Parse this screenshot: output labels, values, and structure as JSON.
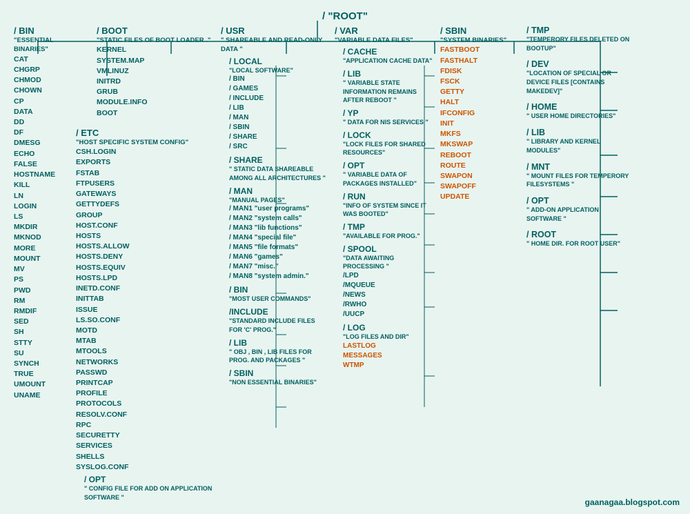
{
  "root": {
    "label": "/   \"ROOT\""
  },
  "bin": {
    "title": "/ BIN",
    "desc": "\"ESSENTIAL BINARIES\"",
    "files": [
      "CAT",
      "CHGRP",
      "CHMOD",
      "CHOWN",
      "CP",
      "DATA",
      "DD",
      "DF",
      "DMESG",
      "ECHO",
      "FALSE",
      "HOSTNAME",
      "KILL",
      "LN",
      "LOGIN",
      "LS",
      "MKDIR",
      "MKNOD",
      "MORE",
      "MOUNT",
      "MV",
      "PS",
      "PWD",
      "RM",
      "RMDIF",
      "SED",
      "SH",
      "STTY",
      "SU",
      "SYNCH",
      "TRUE",
      "UMOUNT",
      "UNAME"
    ]
  },
  "boot": {
    "title": "/ BOOT",
    "desc": "\"STATIC FILES OF BOOT LOADER .\"",
    "files": [
      "KERNEL",
      "SYSTEM.MAP",
      "VMLINUZ",
      "INITRD",
      "GRUB",
      "MODULE.INFO",
      "BOOT"
    ]
  },
  "etc": {
    "title": "/ ETC",
    "desc": "\"HOST SPECIFIC SYSTEM CONFIG\"",
    "files": [
      "CSH.LOGIN",
      "EXPORTS",
      "FSTAB",
      "FTPUSERS",
      "GATEWAYS",
      "GETTYDEFS",
      "GROUP",
      "HOST.CONF",
      "HOSTS",
      "HOSTS.ALLOW",
      "HOSTS.DENY",
      "HOSTS.EQUIV",
      "HOSTS.LPD",
      "INETD.CONF",
      "INITTAB",
      "ISSUE",
      "LS.SO.CONF",
      "MOTD",
      "MTAB",
      "MTOOLS",
      "NETWORKS",
      "PASSWD",
      "PRINTCAP",
      "PROFILE",
      "PROTOCOLS",
      "RESOLV.CONF",
      "RPC",
      "SECURETTY",
      "SERVICES",
      "SHELLS",
      "SYSLOG.CONF"
    ],
    "opt": {
      "title": "/ OPT",
      "desc": "\" CONFIG FILE FOR ADD ON APPLICATION SOFTWARE \""
    }
  },
  "usr": {
    "title": "/ USR",
    "desc": "\" SHAREABLE AND READ-ONLY DATA \"",
    "local": {
      "title": "/ LOCAL",
      "desc": "\"LOCAL SOFTWARE\"",
      "items": [
        "/BIN",
        "/GAMES",
        "/INCLUDE",
        "/LIB",
        "/MAN",
        "/SBIN",
        "/SHARE",
        "/SRC"
      ]
    },
    "share": {
      "title": "/ SHARE",
      "desc": "\" STATIC DATA SHAREABLE AMONG ALL ARCHITECTURES \""
    },
    "man": {
      "title": "/ MAN",
      "desc": "\"MANUAL PAGES\"",
      "items": [
        "/MAN1 \"user programs\"",
        "/MAN2 \"system calls\"",
        "/MAN3 \"lib functions\"",
        "/MAN4 \"special file\"",
        "/MAN5 \"file formats\"",
        "/MAN6 \"games\"",
        "/MAN7 \"misc.\"",
        "/MAN8 \"system admin.\""
      ]
    },
    "bin": {
      "title": "/ BIN",
      "desc": "\"MOST USER COMMANDS\""
    },
    "include": {
      "title": "/INCLUDE",
      "desc": "\"STANDARD INCLUDE FILES FOR 'C' PROG.\""
    },
    "lib": {
      "title": "/ LIB",
      "desc": "\" OBJ , BIN , LIB FILES FOR PROG. AND PACKAGES \""
    },
    "sbin": {
      "title": "/ SBIN",
      "desc": "\"NON ESSENTIAL BINARIES\""
    }
  },
  "var": {
    "title": "/ VAR",
    "desc": "\"VARIABLE DATA FILES\"",
    "cache": {
      "title": "/ CACHE",
      "desc": "\"APPLICATION CACHE DATA\""
    },
    "lib": {
      "title": "/ LIB",
      "desc": "\" VARIABLE STATE INFORMATION REMAINS AFTER REBOOT \""
    },
    "yp": {
      "title": "/ YP",
      "desc": "\" DATA FOR NIS SERVICES \""
    },
    "lock": {
      "title": "/ LOCK",
      "desc": "\"LOCK FILES FOR SHARED RESOURCES\""
    },
    "opt": {
      "title": "/ OPT",
      "desc": "\" VARIABLE DATA OF PACKAGES INSTALLED\""
    },
    "run": {
      "title": "/ RUN",
      "desc": "\"INFO OF SYSTEM SINCE IT WAS BOOTED\""
    },
    "tmp": {
      "title": "/ TMP",
      "desc": "\"AVAILABLE FOR PROG.\""
    },
    "spool": {
      "title": "/ SPOOL",
      "desc": "\"DATA AWAITING PROCESSING \"",
      "items": [
        "/LPD",
        "/MQUEUE",
        "/NEWS",
        "/RWHO",
        "/UUCP"
      ]
    },
    "log": {
      "title": "/ LOG",
      "desc": "\"LOG FILES AND DIR\"",
      "items_orange": [
        "LASTLOG",
        "MESSAGES",
        "WTMP"
      ]
    }
  },
  "sbin": {
    "title": "/ SBIN",
    "desc": "\"SYSTEM BINARIES\"",
    "files_normal": [],
    "files_orange": [
      "FASTBOOT",
      "FASTHALT",
      "FDISK",
      "FSCK",
      "GETTY",
      "HALT",
      "IFCONFIG",
      "INIT",
      "MKFS",
      "MKSWAP",
      "REBOOT",
      "ROUTE",
      "SWAPON",
      "SWAPOFF",
      "UPDATE"
    ]
  },
  "right": {
    "tmp": {
      "title": "/ TMP",
      "desc": "\"TEMPERORY FILES DELETED ON BOOTUP\""
    },
    "dev": {
      "title": "/ DEV",
      "desc": "\"LOCATION OF SPECIAL OR DEVICE FILES [CONTAINS MAKEDEV]\""
    },
    "home": {
      "title": "/ HOME",
      "desc": "\" USER HOME DIRECTORIES\""
    },
    "lib": {
      "title": "/ LIB",
      "desc": "\"  LIBRARY AND KERNEL MODULES\""
    },
    "mnt": {
      "title": "/ MNT",
      "desc": "\"  MOUNT FILES FOR TEMPERORY FILESYSTEMS \""
    },
    "opt": {
      "title": "/ OPT",
      "desc": "\" ADD-ON APPLICATION SOFTWARE \""
    },
    "root": {
      "title": "/ ROOT",
      "desc": "\" HOME DIR. FOR ROOT USER\""
    }
  },
  "watermark": "gaanagaa.blogspot.com"
}
